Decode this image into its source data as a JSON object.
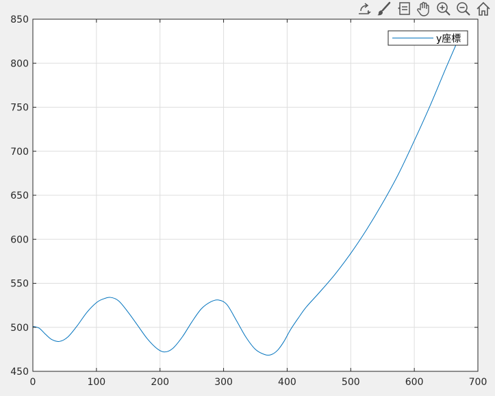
{
  "toolbar": {
    "icons": [
      "export-icon",
      "brush-icon",
      "datatip-icon",
      "pan-hand-icon",
      "zoom-in-icon",
      "zoom-out-icon",
      "home-icon"
    ]
  },
  "colors": {
    "line": "#0072BD",
    "axes_bg": "#ffffff",
    "figure_bg": "#f0f0f0",
    "grid": "#dedede",
    "axis": "#262626"
  },
  "chart_data": {
    "type": "line",
    "title": "",
    "xlabel": "",
    "ylabel": "",
    "xlim": [
      0,
      700
    ],
    "ylim": [
      450,
      850
    ],
    "xticks": [
      0,
      100,
      200,
      300,
      400,
      500,
      600,
      700
    ],
    "yticks": [
      450,
      500,
      550,
      600,
      650,
      700,
      750,
      800,
      850
    ],
    "grid": true,
    "legend": {
      "position": "top-right",
      "entries": [
        "y座標"
      ]
    },
    "series": [
      {
        "name": "y座標",
        "x": [
          0,
          10,
          20,
          30,
          42,
          55,
          70,
          85,
          100,
          110,
          122,
          135,
          150,
          165,
          180,
          195,
          207,
          220,
          235,
          250,
          265,
          280,
          292,
          305,
          320,
          335,
          350,
          365,
          375,
          385,
          395,
          405,
          418,
          430,
          450,
          475,
          500,
          525,
          550,
          575,
          600,
          625,
          650,
          668
        ],
        "y": [
          501,
          499,
          492,
          486,
          484,
          489,
          502,
          517,
          528,
          532,
          534,
          530,
          517,
          502,
          487,
          476,
          472,
          476,
          489,
          506,
          521,
          529,
          531,
          526,
          508,
          489,
          475,
          469,
          469,
          474,
          484,
          497,
          511,
          523,
          539,
          560,
          584,
          611,
          641,
          674,
          712,
          752,
          795,
          825
        ]
      }
    ]
  }
}
